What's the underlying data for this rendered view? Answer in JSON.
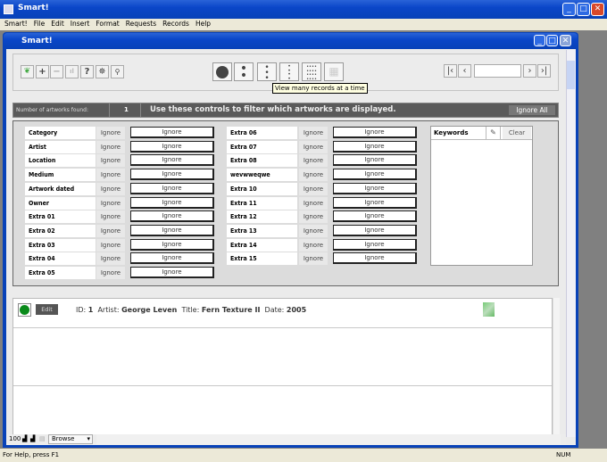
{
  "app": {
    "title": "Smart!",
    "inner_title": "Smart!"
  },
  "menu": [
    "Smart!",
    "File",
    "Edit",
    "Insert",
    "Format",
    "Requests",
    "Records",
    "Help"
  ],
  "toolbar": {
    "tooltip": "View many records at a time",
    "record_input": ""
  },
  "filter_header": {
    "count_label": "Number of artworks found:",
    "count": "1",
    "message": "Use these controls to filter which artworks are displayed.",
    "ignore_all": "Ignore All"
  },
  "filters_col1": [
    "Category",
    "Artist",
    "Location",
    "Medium",
    "Artwork dated",
    "Owner",
    "Extra 01",
    "Extra 02",
    "Extra 03",
    "Extra 04",
    "Extra 05"
  ],
  "filters_col2": [
    "Extra 06",
    "Extra 07",
    "Extra 08",
    "wevwweqwe",
    "Extra 10",
    "Extra 11",
    "Extra 12",
    "Extra 13",
    "Extra 14",
    "Extra 15"
  ],
  "ignore_label": "Ignore",
  "keywords": {
    "label": "Keywords",
    "clear": "Clear"
  },
  "record": {
    "edit": "Edit",
    "id_label": "ID:",
    "id": "1",
    "artist_label": "Artist:",
    "artist": "George Leven",
    "title_label": "Title:",
    "title": "Fern Texture II",
    "date_label": "Date:",
    "date": "2005"
  },
  "bottom": {
    "zoom": "100",
    "mode": "Browse"
  },
  "status": {
    "help": "For Help, press F1",
    "num": "NUM"
  }
}
